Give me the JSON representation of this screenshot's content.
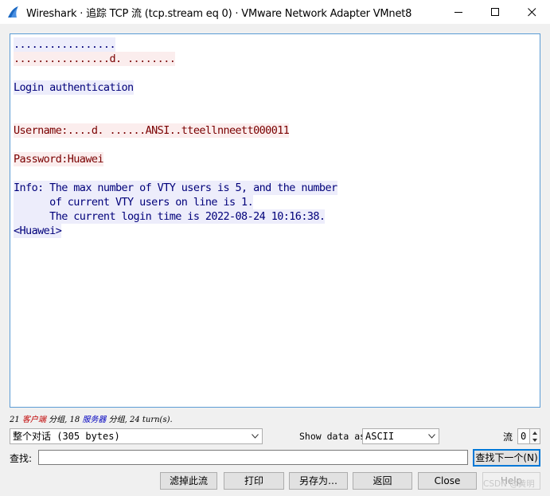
{
  "window": {
    "title": "Wireshark · 追踪 TCP 流 (tcp.stream eq 0) · VMware Network Adapter VMnet8",
    "minimize_icon": "minimize-icon",
    "maximize_icon": "maximize-icon",
    "close_icon": "close-icon"
  },
  "stream": {
    "lines": [
      {
        "text": ".................",
        "side": "server"
      },
      {
        "text": "................d. ........",
        "side": "client"
      },
      {
        "text": "",
        "side": "none"
      },
      {
        "text": "Login authentication",
        "side": "server"
      },
      {
        "text": "",
        "side": "none"
      },
      {
        "text": "",
        "side": "none"
      },
      {
        "text": "Username:....d. ......ANSI..tteellnneett000011",
        "side": "client",
        "prefix": "Username:"
      },
      {
        "text": "",
        "side": "none"
      },
      {
        "text": "Password:Huawei",
        "side": "client",
        "prefix": "Password:"
      },
      {
        "text": "",
        "side": "none"
      },
      {
        "text": "Info: The max number of VTY users is 5, and the number",
        "side": "server"
      },
      {
        "text": "      of current VTY users on line is 1.",
        "side": "server"
      },
      {
        "text": "      The current login time is 2022-08-24 10:16:38.",
        "side": "server"
      },
      {
        "text": "<Huawei>",
        "side": "server"
      }
    ],
    "colors": {
      "client_text": "#7a0000",
      "client_bg": "#fbeded",
      "server_text": "#00007a",
      "server_bg": "#ededfb"
    }
  },
  "status": {
    "client_count": "21",
    "client_label": "客户端",
    "packets_label_1": "分组,",
    "server_count": "18",
    "server_label": "服务器",
    "packets_label_2": "分组,",
    "turns": "24 turn(s)."
  },
  "controls": {
    "conversation_select": "整个对话 (305 bytes)",
    "show_data_as_label": "Show data as",
    "show_data_as_value": "ASCII",
    "stream_label": "流",
    "stream_value": "0",
    "find_label": "查找:",
    "find_value": "",
    "find_next_button": "查找下一个(N)"
  },
  "buttons": {
    "filter_out": "滤掉此流",
    "print": "打印",
    "save_as": "另存为…",
    "back": "返回",
    "close": "Close",
    "help": "Help"
  },
  "watermark": "CSDN @黄明"
}
